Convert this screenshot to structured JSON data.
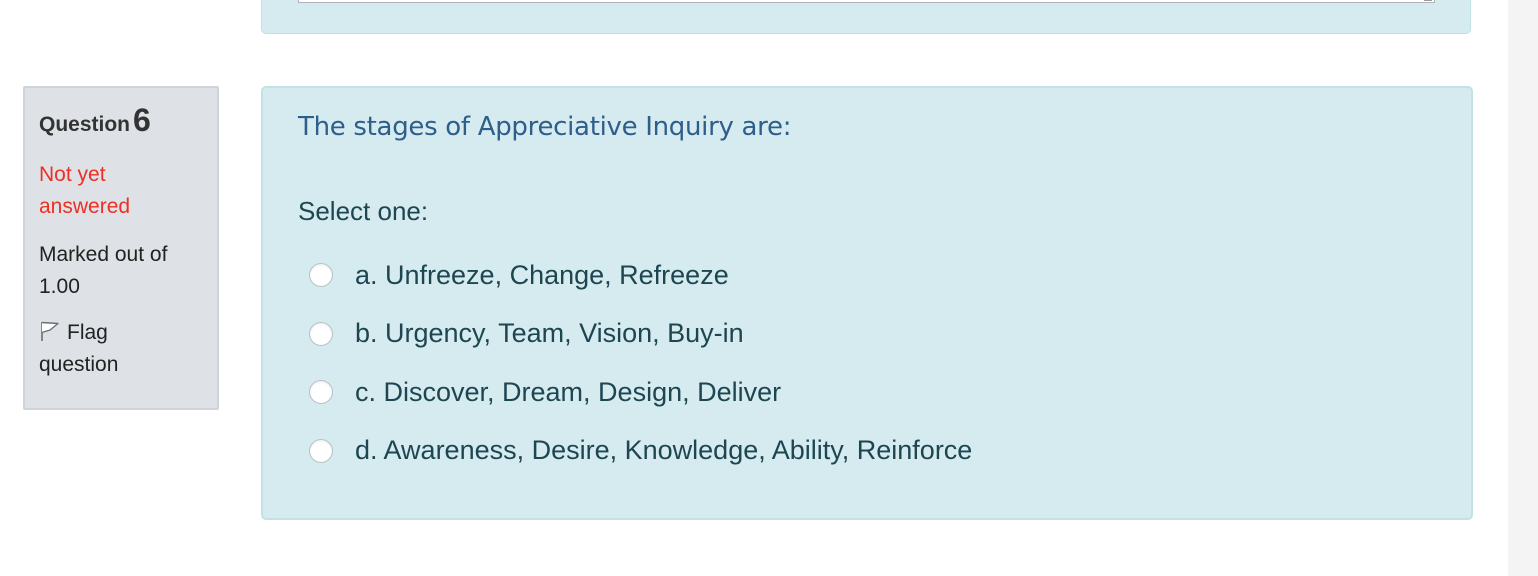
{
  "question": {
    "label": "Question",
    "number": "6",
    "state": "Not yet answered",
    "grade": "Marked out of 1.00",
    "flag_label": "Flag question",
    "text": "The stages of Appreciative Inquiry are:",
    "prompt": "Select one:",
    "answers": [
      {
        "label": "a. Unfreeze, Change, Refreeze"
      },
      {
        "label": "b. Urgency, Team, Vision, Buy-in"
      },
      {
        "label": "c. Discover, Dream, Design, Deliver"
      },
      {
        "label": "d. Awareness, Desire, Knowledge, Ability, Reinforce"
      }
    ]
  },
  "colors": {
    "panel_bg": "#d6ebf0",
    "info_bg": "#dee2e6",
    "state_red": "#ec3025",
    "question_text": "#2e5e8a",
    "answer_text": "#1d4651"
  },
  "icons": {
    "flag": "flag-outline-icon"
  }
}
